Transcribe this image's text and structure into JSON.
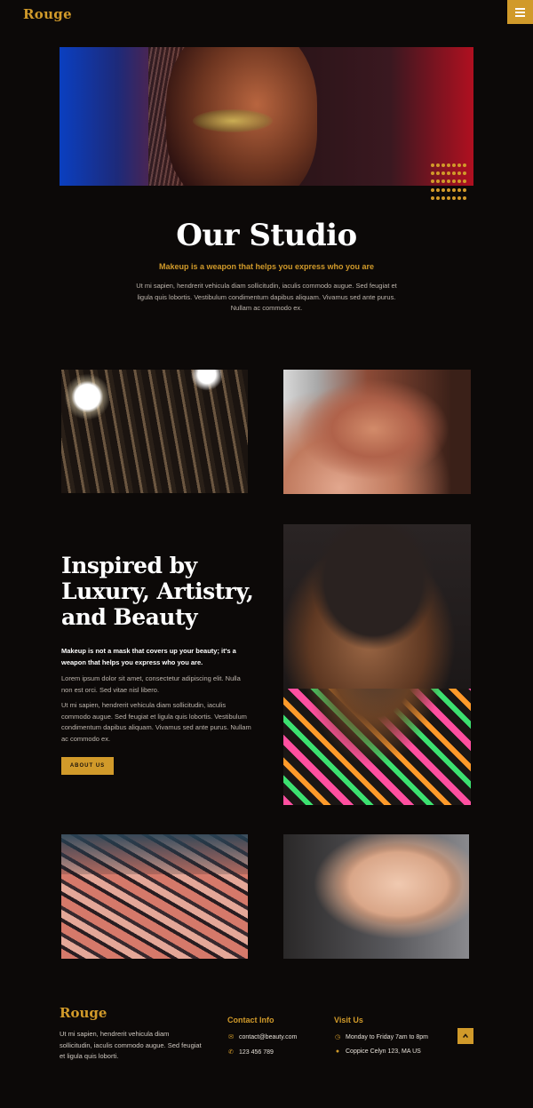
{
  "brand": {
    "name": "Rouge",
    "accent": "#d19a2a"
  },
  "header": {
    "menu_icon": "hamburger-icon"
  },
  "studio": {
    "title": "Our Studio",
    "subtitle": "Makeup is a weapon that helps you express who you are",
    "body": "Ut mi sapien, hendrerit vehicula diam sollicitudin, iaculis commodo augue. Sed feugiat et ligula quis lobortis. Vestibulum condimentum dapibus aliquam. Vivamus sed ante purus. Nullam ac commodo ex."
  },
  "inspired": {
    "title": "Inspired by Luxury, Artistry, and Beauty",
    "lead": "Makeup is not a mask that covers up your beauty; it's a weapon that helps you express who you are.",
    "p1": "Lorem ipsum dolor sit amet, consectetur adipiscing elit. Nulla non est orci. Sed vitae nisl libero.",
    "p2": "Ut mi sapien, hendrerit vehicula diam sollicitudin, iaculis commodo augue. Sed feugiat et ligula quis lobortis. Vestibulum condimentum dapibus aliquam. Vivamus sed ante purus. Nullam ac commodo ex.",
    "button": "ABOUT US"
  },
  "footer": {
    "logo": "Rouge",
    "text": "Ut mi sapien, hendrerit vehicula diam sollicitudin, iaculis commodo augue. Sed feugiat et ligula quis loborti.",
    "contact": {
      "heading": "Contact Info",
      "email": "contact@beauty.com",
      "phone": "123 456 789"
    },
    "visit": {
      "heading": "Visit Us",
      "hours": "Monday to Friday 7am to 8pm",
      "address": "Coppice Celyn 123, MA US"
    },
    "to_top_icon": "chevron-up-icon"
  }
}
